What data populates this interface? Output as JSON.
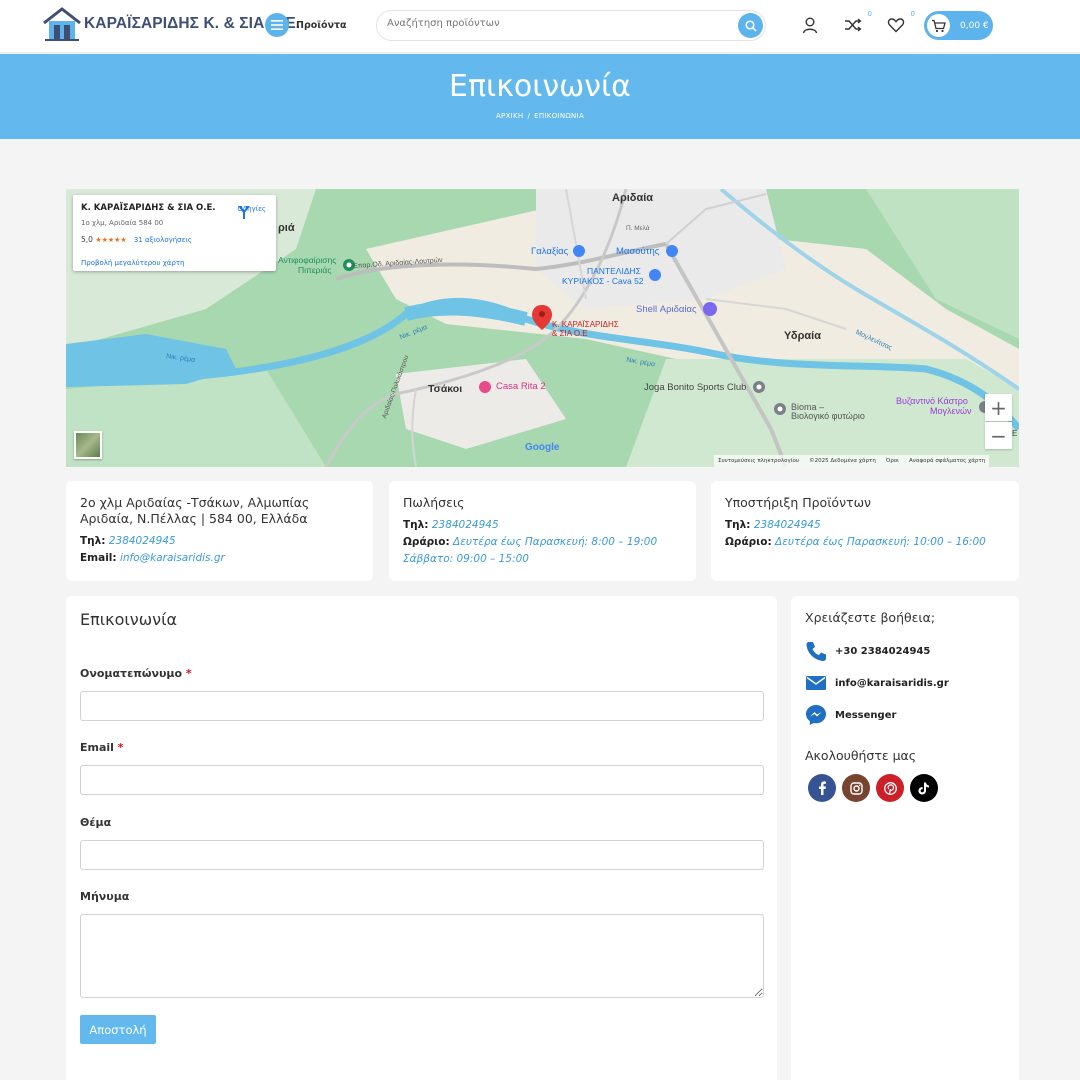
{
  "header": {
    "logo_text": "ΚΑΡΑΪΣΑΡΙΔΗΣ Κ. & ΣΙΑ Ο.Ε.",
    "menu_label": "Προϊόντα",
    "search_placeholder": "Αναζήτηση προϊόντων",
    "compare_count": "0",
    "wishlist_count": "0",
    "cart_total": "0,00 €",
    "accent_color": "#5db4ec"
  },
  "hero": {
    "title": "Επικοινωνία",
    "breadcrumb": [
      "ΑΡΧΙΚΗ",
      "/",
      "ΕΠΙΚΟΙΝΩΝΙΑ"
    ]
  },
  "map": {
    "card_title": "Κ. ΚΑΡΑΪΣΑΡΙΔΗΣ & ΣΙΑ Ο.Ε.",
    "card_address": "1ο χλμ, Αριδαία 584 00",
    "rating": "5,0",
    "stars": "★★★★★",
    "reviews_link": "31 αξιολογήσεις",
    "larger_map_link": "Προβολή μεγαλύτερου χάρτη",
    "directions_label": "Οδηγίες",
    "pin_label_line1": "Κ. ΚΑΡΑΪΣΑΡΙΔΗΣ",
    "pin_label_line2": "& ΣΙΑ Ο.Ε",
    "places": {
      "aridaia": "Αριδαία",
      "ydraia": "Υδραία",
      "tsakoi": "Τσάκοι",
      "galaxias": "Γαλαξίας",
      "masoutis": "Μασούτης",
      "panteleidis_1": "ΠΑΝΤΕΛΙΔΗΣ",
      "panteleidis_2": "ΚΥΡΙΑΚΟΣ - Cava 52",
      "shell": "Shell Αριδαίας",
      "casa_rita": "Casa Rita 2",
      "joga_bonito": "Joga Bonito Sports Club",
      "bioma_1": "Bioma –",
      "bioma_2": "Βιολογικό φυτώριο",
      "vyzantino_1": "Βυζαντινό Κάστρο",
      "vyzantino_2": "Μογλενών",
      "antiforfairisis_1": "Αντιφοφαίρισης",
      "antiforfairisis_2": "Πιπεριάς",
      "pieria_partial": "ριά",
      "road_aridaias": "Επαρ.Οδ. Αριδαίας-Λουτρών",
      "road_tsakon": "Αριδαίας-Πολυκάστρου",
      "river_1": "Νικ. ρέμα",
      "river_2": "Νικ. ρέμα",
      "river_3": "Νικ. ρέμα",
      "moglenitsas": "Μογλενίτσας",
      "p_melo": "Π. Μελά",
      "edge_e": "E",
      "google": "Google"
    },
    "footer": [
      "Συντομεύσεις πληκτρολογίου",
      "©2025 Δεδομένα χάρτη",
      "Όροι",
      "Αναφορά σφάλματος χάρτη"
    ]
  },
  "info_cards": [
    {
      "title_line1": "2ο χλμ Αριδαίας -Τσάκων, Αλμωπίας",
      "title_line2": "Αριδαία, Ν.Πέλλας | 584 00, Ελλάδα",
      "phone_label": "Τηλ:",
      "phone": "2384024945",
      "email_label": "Email:",
      "email": "info@karaisaridis.gr"
    },
    {
      "title": "Πωλήσεις",
      "phone_label": "Τηλ:",
      "phone": "2384024945",
      "hours_label": "Ωράριο:",
      "hours": "Δευτέρα έως Παρασκευή: 8:00 – 19:00",
      "saturday": "Σάββατο: 09:00 – 15:00"
    },
    {
      "title": "Υποστήριξη Προϊόντων",
      "phone_label": "Τηλ:",
      "phone": "2384024945",
      "hours_label": "Ωράριο:",
      "hours": "Δευτέρα έως Παρασκευή: 10:00 – 16:00"
    }
  ],
  "form": {
    "title": "Επικοινωνία",
    "name_label": "Ονοματεπώνυμο",
    "email_label": "Email",
    "subject_label": "Θέμα",
    "message_label": "Μήνυμα",
    "required_mark": "*",
    "name_value": "",
    "email_value": "",
    "subject_value": "",
    "message_value": "",
    "submit_label": "Αποστολή"
  },
  "sidebar": {
    "help_title": "Χρειάζεστε βοήθεια;",
    "phone": "+30 2384024945",
    "email": "info@karaisaridis.gr",
    "messenger": "Messenger",
    "follow_title": "Ακολουθήστε μας",
    "social": [
      {
        "icon": "facebook-icon",
        "color": "#365493"
      },
      {
        "icon": "instagram-icon",
        "color": "#774430"
      },
      {
        "icon": "pinterest-icon",
        "color": "#cb2027"
      },
      {
        "icon": "tiktok-icon",
        "color": "#000000"
      }
    ]
  }
}
